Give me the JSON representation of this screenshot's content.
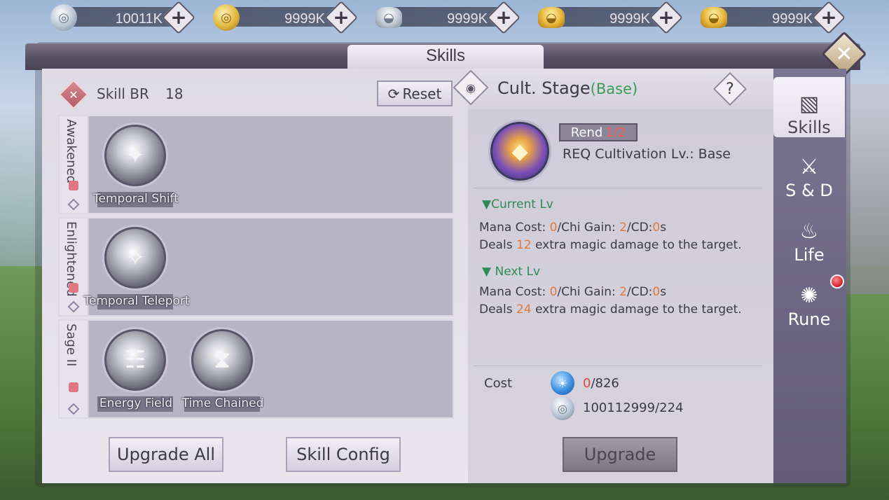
{
  "currencies": [
    {
      "icon": "silver-coin-icon",
      "value": "10011K"
    },
    {
      "icon": "gold-coin-icon",
      "value": "9999K"
    },
    {
      "icon": "silver-ingot-icon",
      "value": "9999K"
    },
    {
      "icon": "gold-ingot-locked-icon",
      "value": "9999K"
    },
    {
      "icon": "gold-ingot-icon",
      "value": "9999K"
    }
  ],
  "window": {
    "title": "Skills"
  },
  "left": {
    "br_label": "Skill BR",
    "br_value": "18",
    "reset_label": "Reset",
    "rows": [
      {
        "label": "Awakened",
        "skills": [
          "Temporal Shift"
        ]
      },
      {
        "label": "Enlightened",
        "skills": [
          "Temporal Teleport"
        ]
      },
      {
        "label": "Sage II",
        "skills": [
          "Energy Field",
          "Time Chained"
        ]
      }
    ],
    "upgrade_all_label": "Upgrade All",
    "skill_config_label": "Skill Config"
  },
  "right": {
    "stage_title": "Cult. Stage",
    "stage_sub": "(Base)",
    "help": "?",
    "skill_name": "Rend",
    "skill_level": "1/2",
    "req": "REQ Cultivation Lv.: Base",
    "current": {
      "heading": "Current Lv",
      "mana_label": "Mana Cost: ",
      "mana": "0",
      "chi_label": "/Chi Gain: ",
      "chi": "2",
      "cd_label": "/CD:",
      "cd": "0",
      "cd_unit": "s",
      "deals_pre": "Deals ",
      "damage": "12",
      "deals_post": " extra magic damage to the target."
    },
    "next": {
      "heading": "Next Lv",
      "mana_label": "Mana Cost: ",
      "mana": "0",
      "chi_label": "/Chi Gain: ",
      "chi": "2",
      "cd_label": "/CD:",
      "cd": "0",
      "cd_unit": "s",
      "deals_pre": "Deals ",
      "damage": "24",
      "deals_post": " extra magic damage to the target."
    },
    "cost_label": "Cost",
    "cost_mana_have": "0",
    "cost_mana_need": "/826",
    "cost_silver": "100112999/224",
    "upgrade_label": "Upgrade"
  },
  "tabs": [
    {
      "label": "Skills",
      "icon": "skills-book-icon",
      "active": true
    },
    {
      "label": "S & D",
      "icon": "sword-icon",
      "active": false
    },
    {
      "label": "Life",
      "icon": "cauldron-icon",
      "active": false
    },
    {
      "label": "Rune",
      "icon": "dragon-rune-icon",
      "active": false
    }
  ],
  "colors": {
    "accent_green": "#3a9a5a",
    "value_orange": "#e07a3a",
    "alert_red": "#d21e2a"
  }
}
